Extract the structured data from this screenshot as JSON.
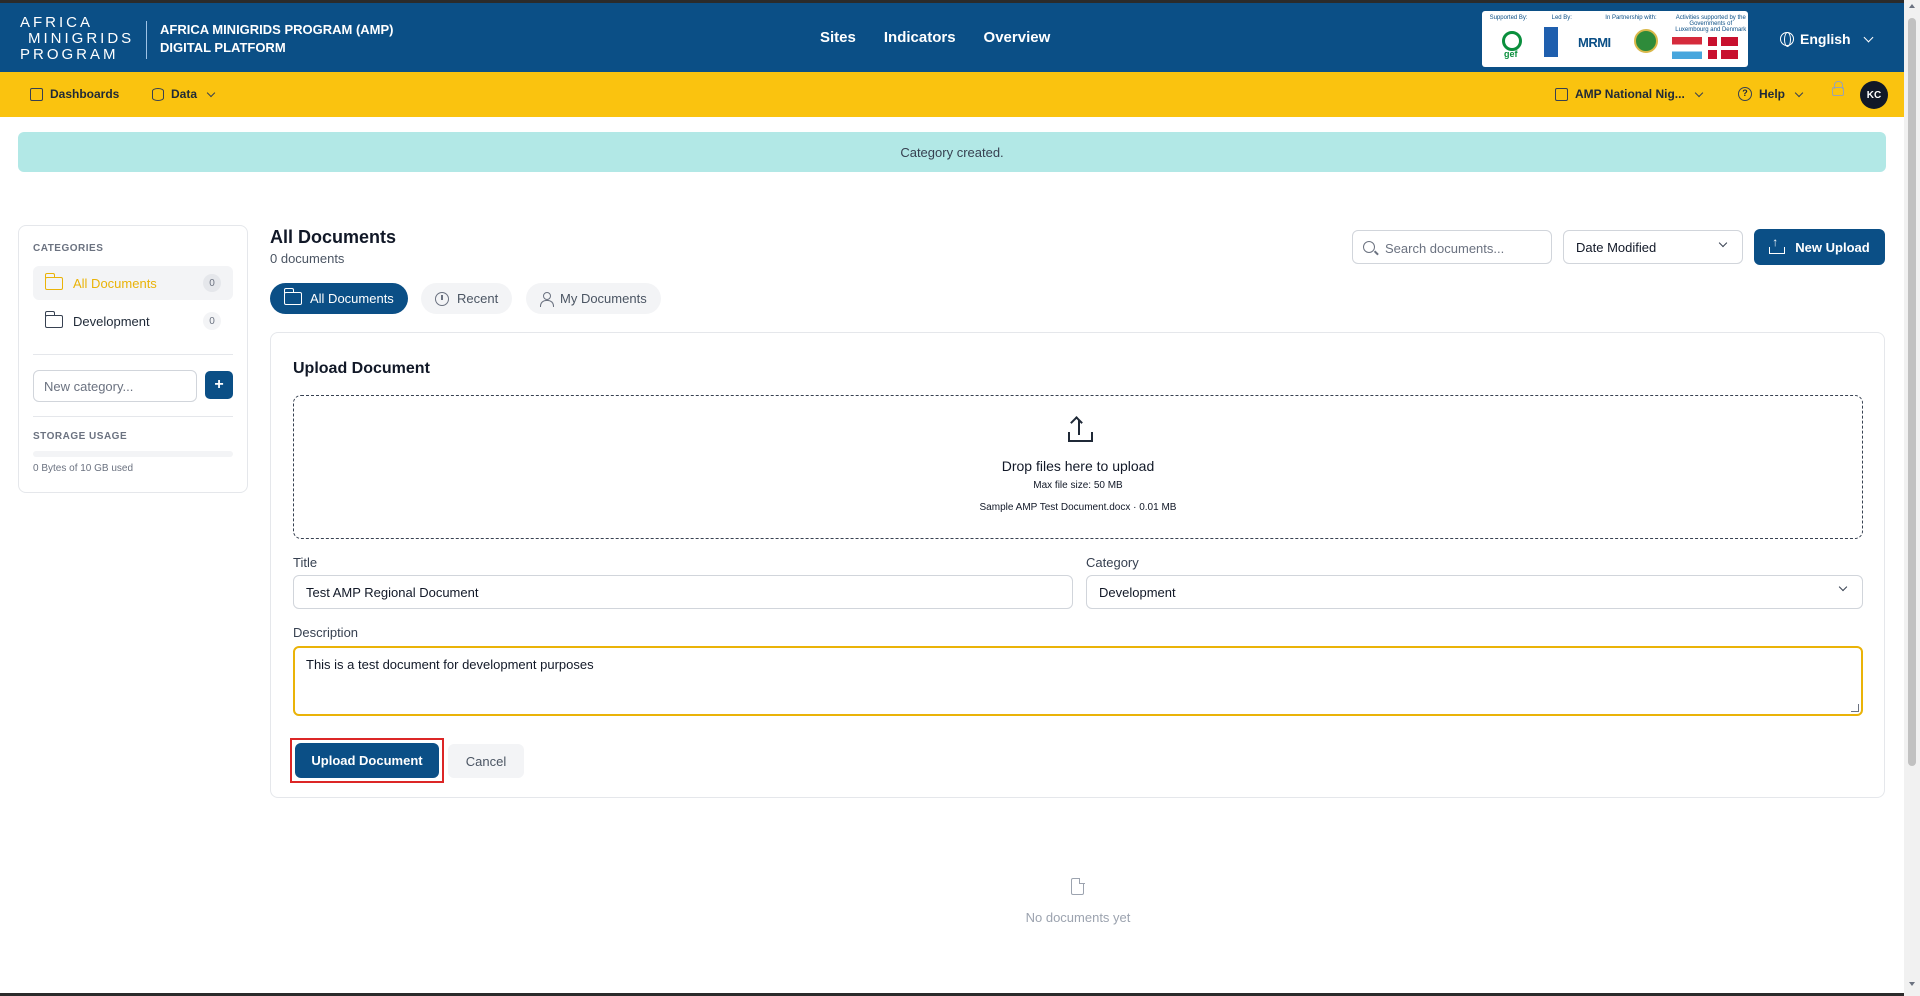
{
  "header": {
    "logo_lines": [
      "AFRICA",
      "MINIGRIDS",
      "PROGRAM"
    ],
    "brand_line1": "AFRICA MINIGRIDS PROGRAM (AMP)",
    "brand_line2": "DIGITAL PLATFORM",
    "nav": [
      "Sites",
      "Indicators",
      "Overview"
    ],
    "partners": {
      "supported_by": "Supported By:",
      "led_by": "Led By:",
      "in_partnership": "In Partnership with:",
      "activities": "Activities supported by the Governments of Luxembourg and Denmark",
      "gef": "gef",
      "mrmi": "MRMI"
    },
    "language": "English"
  },
  "subnav": {
    "dashboards": "Dashboards",
    "data": "Data",
    "org": "AMP National Nig...",
    "help": "Help",
    "avatar_initials": "KC"
  },
  "alert": {
    "message": "Category created."
  },
  "sidebar": {
    "categories_title": "CATEGORIES",
    "items": [
      {
        "label": "All Documents",
        "count": "0",
        "active": true
      },
      {
        "label": "Development",
        "count": "0",
        "active": false
      }
    ],
    "new_category_placeholder": "New category...",
    "add_label": "+",
    "storage_title": "STORAGE USAGE",
    "storage_text": "0 Bytes of 10 GB used",
    "storage_fraction": 0
  },
  "main": {
    "title": "All Documents",
    "subtitle": "0 documents",
    "search_placeholder": "Search documents...",
    "sort_value": "Date Modified",
    "new_upload_label": "New Upload",
    "tabs": [
      {
        "label": "All Documents",
        "icon": "folder-icon",
        "active": true
      },
      {
        "label": "Recent",
        "icon": "clock-icon",
        "active": false
      },
      {
        "label": "My Documents",
        "icon": "user-icon",
        "active": false
      }
    ]
  },
  "upload": {
    "title": "Upload Document",
    "drop_text": "Drop files here to upload",
    "max_size": "Max file size: 50 MB",
    "selected_file": "Sample AMP Test Document.docx · 0.01 MB",
    "title_label": "Title",
    "title_value": "Test AMP Regional Document",
    "category_label": "Category",
    "category_value": "Development",
    "description_label": "Description",
    "description_value": "This is a test document for development purposes",
    "upload_button": "Upload Document",
    "cancel_button": "Cancel"
  },
  "empty_state": {
    "text": "No documents yet"
  },
  "colors": {
    "primary": "#0b4f86",
    "accent": "#fac30f",
    "alert_bg": "#b2e8e6",
    "focus": "#eab308",
    "highlight": "#dc2626"
  }
}
